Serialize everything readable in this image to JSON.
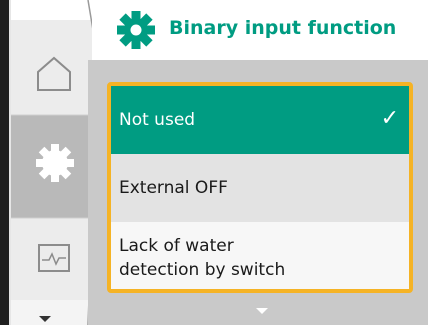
{
  "header": {
    "title": "Binary input function",
    "icon": "gear-icon",
    "accent": "#009c82"
  },
  "nav": {
    "items": [
      {
        "name": "home",
        "icon": "home-icon",
        "active": false
      },
      {
        "name": "settings",
        "icon": "gear-icon",
        "active": true
      },
      {
        "name": "diagnostics",
        "icon": "pulse-monitor-icon",
        "active": false
      }
    ]
  },
  "menu": {
    "options": [
      {
        "label": "Not used",
        "selected": true
      },
      {
        "label": "External OFF",
        "selected": false
      },
      {
        "label_line1": "Lack of water",
        "label_line2": "detection by switch",
        "selected": false
      }
    ],
    "check_mark": "✓",
    "highlight": "#f5b325"
  }
}
